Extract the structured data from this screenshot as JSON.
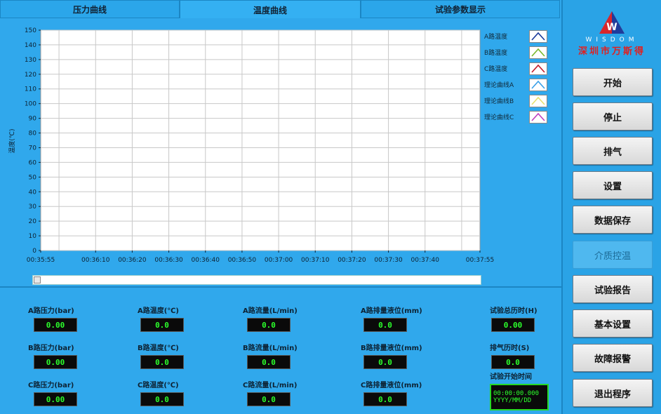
{
  "tabs": [
    {
      "label": "压力曲线"
    },
    {
      "label": "温度曲线"
    },
    {
      "label": "试验参数显示"
    }
  ],
  "chart": {
    "ylabel": "温度(℃)",
    "y_ticks": [
      "150",
      "140",
      "130",
      "120",
      "110",
      "100",
      "90",
      "80",
      "70",
      "60",
      "50",
      "40",
      "30",
      "20",
      "10",
      "0"
    ],
    "x_ticks": [
      "00:35:55",
      "00:36:10",
      "00:36:20",
      "00:36:30",
      "00:36:40",
      "00:36:50",
      "00:37:00",
      "00:37:10",
      "00:37:20",
      "00:37:30",
      "00:37:40",
      "00:37:55"
    ]
  },
  "chart_data": {
    "type": "line",
    "title": "",
    "xlabel": "",
    "ylabel": "温度(℃)",
    "ylim": [
      0,
      150
    ],
    "x_range": [
      "00:35:55",
      "00:37:55"
    ],
    "grid": true,
    "legend_placement": "right",
    "series": [
      {
        "name": "A路温度",
        "color": "#1a3a9a",
        "values": []
      },
      {
        "name": "B路温度",
        "color": "#7ab82e",
        "values": []
      },
      {
        "name": "C路温度",
        "color": "#c01a2a",
        "values": []
      },
      {
        "name": "理论曲线A",
        "color": "#3aa0e8",
        "values": []
      },
      {
        "name": "理论曲线B",
        "color": "#e8e070",
        "values": []
      },
      {
        "name": "理论曲线C",
        "color": "#c040c0",
        "values": []
      }
    ]
  },
  "readouts": {
    "col1": [
      {
        "label": "A路压力(bar)",
        "value": "0.00"
      },
      {
        "label": "B路压力(bar)",
        "value": "0.00"
      },
      {
        "label": "C路压力(bar)",
        "value": "0.00"
      }
    ],
    "col2": [
      {
        "label": "A路温度(℃)",
        "value": "0.0"
      },
      {
        "label": "B路温度(℃)",
        "value": "0.0"
      },
      {
        "label": "C路温度(℃)",
        "value": "0.0"
      }
    ],
    "col3": [
      {
        "label": "A路流量(L/min)",
        "value": "0.0"
      },
      {
        "label": "B路流量(L/min)",
        "value": "0.0"
      },
      {
        "label": "C路流量(L/min)",
        "value": "0.0"
      }
    ],
    "col4": [
      {
        "label": "A路排量液位(mm)",
        "value": "0.0"
      },
      {
        "label": "B路排量液位(mm)",
        "value": "0.0"
      },
      {
        "label": "C路排量液位(mm)",
        "value": "0.0"
      }
    ],
    "col5": [
      {
        "label": "试验总历时(H)",
        "value": "0.00"
      },
      {
        "label": "排气历时(S)",
        "value": "0.0"
      }
    ],
    "start_time": {
      "label": "试验开始时间",
      "time": "00:00:00.000",
      "date": "YYYY/MM/DD"
    }
  },
  "logo": {
    "mark": "W",
    "latin": "WISDOM",
    "cn": "深圳市万斯得"
  },
  "buttons": [
    {
      "label": "开始",
      "enabled": true
    },
    {
      "label": "停止",
      "enabled": true
    },
    {
      "label": "排气",
      "enabled": true
    },
    {
      "label": "设置",
      "enabled": true
    },
    {
      "label": "数据保存",
      "enabled": true
    },
    {
      "label": "介质控温",
      "enabled": false
    },
    {
      "label": "试验报告",
      "enabled": true
    },
    {
      "label": "基本设置",
      "enabled": true
    },
    {
      "label": "故障报警",
      "enabled": true
    },
    {
      "label": "退出程序",
      "enabled": true
    }
  ]
}
